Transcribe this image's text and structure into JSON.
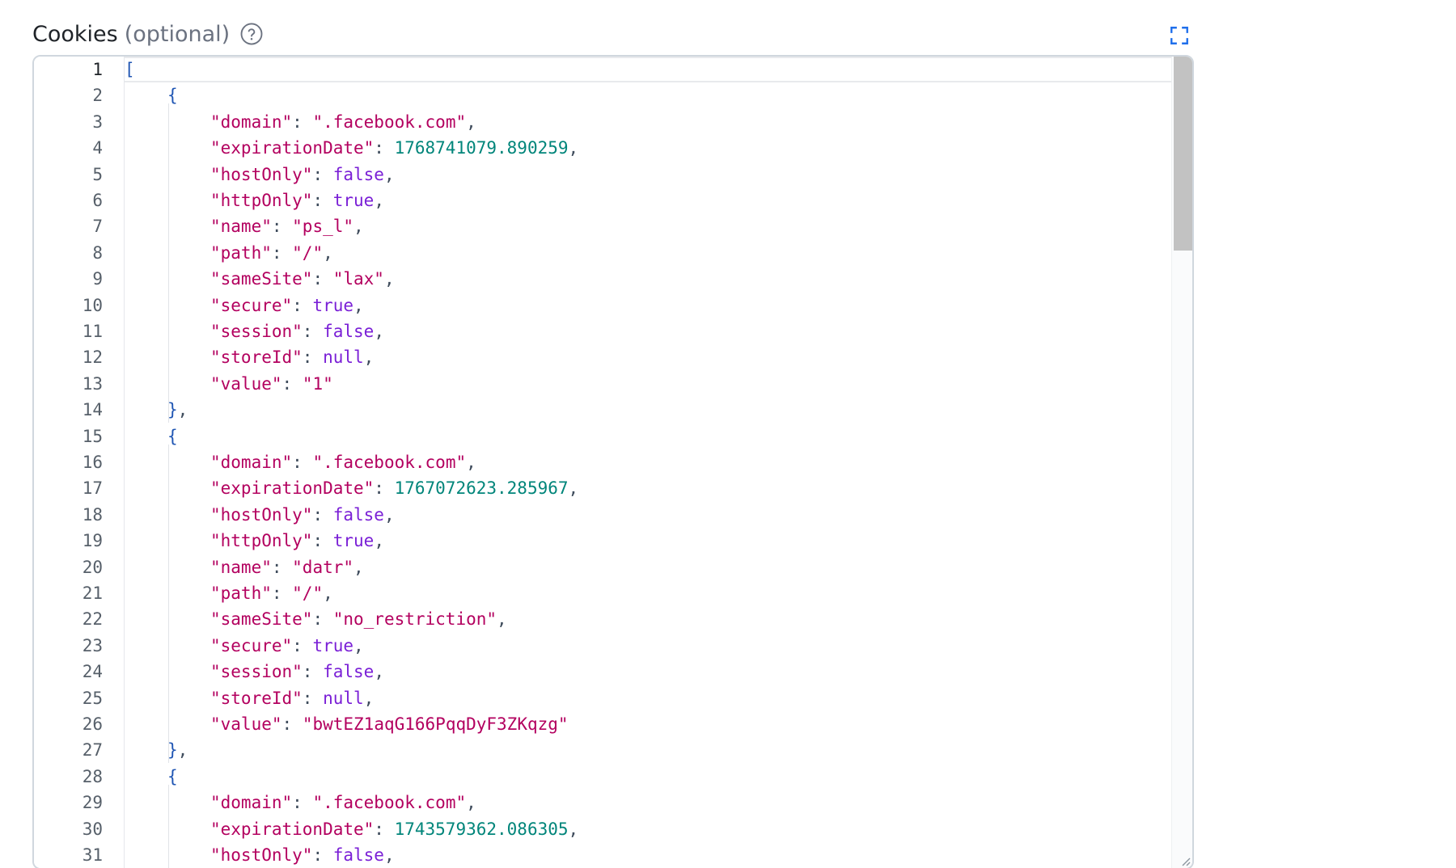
{
  "field": {
    "label": "Cookies",
    "optional_text": "(optional)",
    "help_icon": "question-circle-icon",
    "expand_icon": "fullscreen-expand-icon"
  },
  "editor": {
    "language": "json",
    "active_line": 1,
    "colors": {
      "key": "#b3005f",
      "string": "#b3005f",
      "number": "#00857a",
      "keyword": "#7a1fd6",
      "bracket": "#1f55b3"
    },
    "lines": [
      {
        "n": "1",
        "indent": 0,
        "tokens": [
          {
            "t": "brk",
            "v": "["
          }
        ]
      },
      {
        "n": "2",
        "indent": 1,
        "tokens": [
          {
            "t": "brk",
            "v": "{"
          }
        ]
      },
      {
        "n": "3",
        "indent": 2,
        "tokens": [
          {
            "t": "key",
            "v": "\"domain\""
          },
          {
            "t": "pun",
            "v": ": "
          },
          {
            "t": "str",
            "v": "\".facebook.com\""
          },
          {
            "t": "pun",
            "v": ","
          }
        ]
      },
      {
        "n": "4",
        "indent": 2,
        "tokens": [
          {
            "t": "key",
            "v": "\"expirationDate\""
          },
          {
            "t": "pun",
            "v": ": "
          },
          {
            "t": "num",
            "v": "1768741079.890259"
          },
          {
            "t": "pun",
            "v": ","
          }
        ]
      },
      {
        "n": "5",
        "indent": 2,
        "tokens": [
          {
            "t": "key",
            "v": "\"hostOnly\""
          },
          {
            "t": "pun",
            "v": ": "
          },
          {
            "t": "kw",
            "v": "false"
          },
          {
            "t": "pun",
            "v": ","
          }
        ]
      },
      {
        "n": "6",
        "indent": 2,
        "tokens": [
          {
            "t": "key",
            "v": "\"httpOnly\""
          },
          {
            "t": "pun",
            "v": ": "
          },
          {
            "t": "kw",
            "v": "true"
          },
          {
            "t": "pun",
            "v": ","
          }
        ]
      },
      {
        "n": "7",
        "indent": 2,
        "tokens": [
          {
            "t": "key",
            "v": "\"name\""
          },
          {
            "t": "pun",
            "v": ": "
          },
          {
            "t": "str",
            "v": "\"ps_l\""
          },
          {
            "t": "pun",
            "v": ","
          }
        ]
      },
      {
        "n": "8",
        "indent": 2,
        "tokens": [
          {
            "t": "key",
            "v": "\"path\""
          },
          {
            "t": "pun",
            "v": ": "
          },
          {
            "t": "str",
            "v": "\"/\""
          },
          {
            "t": "pun",
            "v": ","
          }
        ]
      },
      {
        "n": "9",
        "indent": 2,
        "tokens": [
          {
            "t": "key",
            "v": "\"sameSite\""
          },
          {
            "t": "pun",
            "v": ": "
          },
          {
            "t": "str",
            "v": "\"lax\""
          },
          {
            "t": "pun",
            "v": ","
          }
        ]
      },
      {
        "n": "10",
        "indent": 2,
        "tokens": [
          {
            "t": "key",
            "v": "\"secure\""
          },
          {
            "t": "pun",
            "v": ": "
          },
          {
            "t": "kw",
            "v": "true"
          },
          {
            "t": "pun",
            "v": ","
          }
        ]
      },
      {
        "n": "11",
        "indent": 2,
        "tokens": [
          {
            "t": "key",
            "v": "\"session\""
          },
          {
            "t": "pun",
            "v": ": "
          },
          {
            "t": "kw",
            "v": "false"
          },
          {
            "t": "pun",
            "v": ","
          }
        ]
      },
      {
        "n": "12",
        "indent": 2,
        "tokens": [
          {
            "t": "key",
            "v": "\"storeId\""
          },
          {
            "t": "pun",
            "v": ": "
          },
          {
            "t": "kw",
            "v": "null"
          },
          {
            "t": "pun",
            "v": ","
          }
        ]
      },
      {
        "n": "13",
        "indent": 2,
        "tokens": [
          {
            "t": "key",
            "v": "\"value\""
          },
          {
            "t": "pun",
            "v": ": "
          },
          {
            "t": "str",
            "v": "\"1\""
          }
        ]
      },
      {
        "n": "14",
        "indent": 1,
        "tokens": [
          {
            "t": "brk",
            "v": "}"
          },
          {
            "t": "pun",
            "v": ","
          }
        ]
      },
      {
        "n": "15",
        "indent": 1,
        "tokens": [
          {
            "t": "brk",
            "v": "{"
          }
        ]
      },
      {
        "n": "16",
        "indent": 2,
        "tokens": [
          {
            "t": "key",
            "v": "\"domain\""
          },
          {
            "t": "pun",
            "v": ": "
          },
          {
            "t": "str",
            "v": "\".facebook.com\""
          },
          {
            "t": "pun",
            "v": ","
          }
        ]
      },
      {
        "n": "17",
        "indent": 2,
        "tokens": [
          {
            "t": "key",
            "v": "\"expirationDate\""
          },
          {
            "t": "pun",
            "v": ": "
          },
          {
            "t": "num",
            "v": "1767072623.285967"
          },
          {
            "t": "pun",
            "v": ","
          }
        ]
      },
      {
        "n": "18",
        "indent": 2,
        "tokens": [
          {
            "t": "key",
            "v": "\"hostOnly\""
          },
          {
            "t": "pun",
            "v": ": "
          },
          {
            "t": "kw",
            "v": "false"
          },
          {
            "t": "pun",
            "v": ","
          }
        ]
      },
      {
        "n": "19",
        "indent": 2,
        "tokens": [
          {
            "t": "key",
            "v": "\"httpOnly\""
          },
          {
            "t": "pun",
            "v": ": "
          },
          {
            "t": "kw",
            "v": "true"
          },
          {
            "t": "pun",
            "v": ","
          }
        ]
      },
      {
        "n": "20",
        "indent": 2,
        "tokens": [
          {
            "t": "key",
            "v": "\"name\""
          },
          {
            "t": "pun",
            "v": ": "
          },
          {
            "t": "str",
            "v": "\"datr\""
          },
          {
            "t": "pun",
            "v": ","
          }
        ]
      },
      {
        "n": "21",
        "indent": 2,
        "tokens": [
          {
            "t": "key",
            "v": "\"path\""
          },
          {
            "t": "pun",
            "v": ": "
          },
          {
            "t": "str",
            "v": "\"/\""
          },
          {
            "t": "pun",
            "v": ","
          }
        ]
      },
      {
        "n": "22",
        "indent": 2,
        "tokens": [
          {
            "t": "key",
            "v": "\"sameSite\""
          },
          {
            "t": "pun",
            "v": ": "
          },
          {
            "t": "str",
            "v": "\"no_restriction\""
          },
          {
            "t": "pun",
            "v": ","
          }
        ]
      },
      {
        "n": "23",
        "indent": 2,
        "tokens": [
          {
            "t": "key",
            "v": "\"secure\""
          },
          {
            "t": "pun",
            "v": ": "
          },
          {
            "t": "kw",
            "v": "true"
          },
          {
            "t": "pun",
            "v": ","
          }
        ]
      },
      {
        "n": "24",
        "indent": 2,
        "tokens": [
          {
            "t": "key",
            "v": "\"session\""
          },
          {
            "t": "pun",
            "v": ": "
          },
          {
            "t": "kw",
            "v": "false"
          },
          {
            "t": "pun",
            "v": ","
          }
        ]
      },
      {
        "n": "25",
        "indent": 2,
        "tokens": [
          {
            "t": "key",
            "v": "\"storeId\""
          },
          {
            "t": "pun",
            "v": ": "
          },
          {
            "t": "kw",
            "v": "null"
          },
          {
            "t": "pun",
            "v": ","
          }
        ]
      },
      {
        "n": "26",
        "indent": 2,
        "tokens": [
          {
            "t": "key",
            "v": "\"value\""
          },
          {
            "t": "pun",
            "v": ": "
          },
          {
            "t": "str",
            "v": "\"bwtEZ1aqG166PqqDyF3ZKqzg\""
          }
        ]
      },
      {
        "n": "27",
        "indent": 1,
        "tokens": [
          {
            "t": "brk",
            "v": "}"
          },
          {
            "t": "pun",
            "v": ","
          }
        ]
      },
      {
        "n": "28",
        "indent": 1,
        "tokens": [
          {
            "t": "brk",
            "v": "{"
          }
        ]
      },
      {
        "n": "29",
        "indent": 2,
        "tokens": [
          {
            "t": "key",
            "v": "\"domain\""
          },
          {
            "t": "pun",
            "v": ": "
          },
          {
            "t": "str",
            "v": "\".facebook.com\""
          },
          {
            "t": "pun",
            "v": ","
          }
        ]
      },
      {
        "n": "30",
        "indent": 2,
        "tokens": [
          {
            "t": "key",
            "v": "\"expirationDate\""
          },
          {
            "t": "pun",
            "v": ": "
          },
          {
            "t": "num",
            "v": "1743579362.086305"
          },
          {
            "t": "pun",
            "v": ","
          }
        ]
      },
      {
        "n": "31",
        "indent": 2,
        "tokens": [
          {
            "t": "key",
            "v": "\"hostOnly\""
          },
          {
            "t": "pun",
            "v": ": "
          },
          {
            "t": "kw",
            "v": "false"
          },
          {
            "t": "pun",
            "v": ","
          }
        ]
      }
    ]
  }
}
